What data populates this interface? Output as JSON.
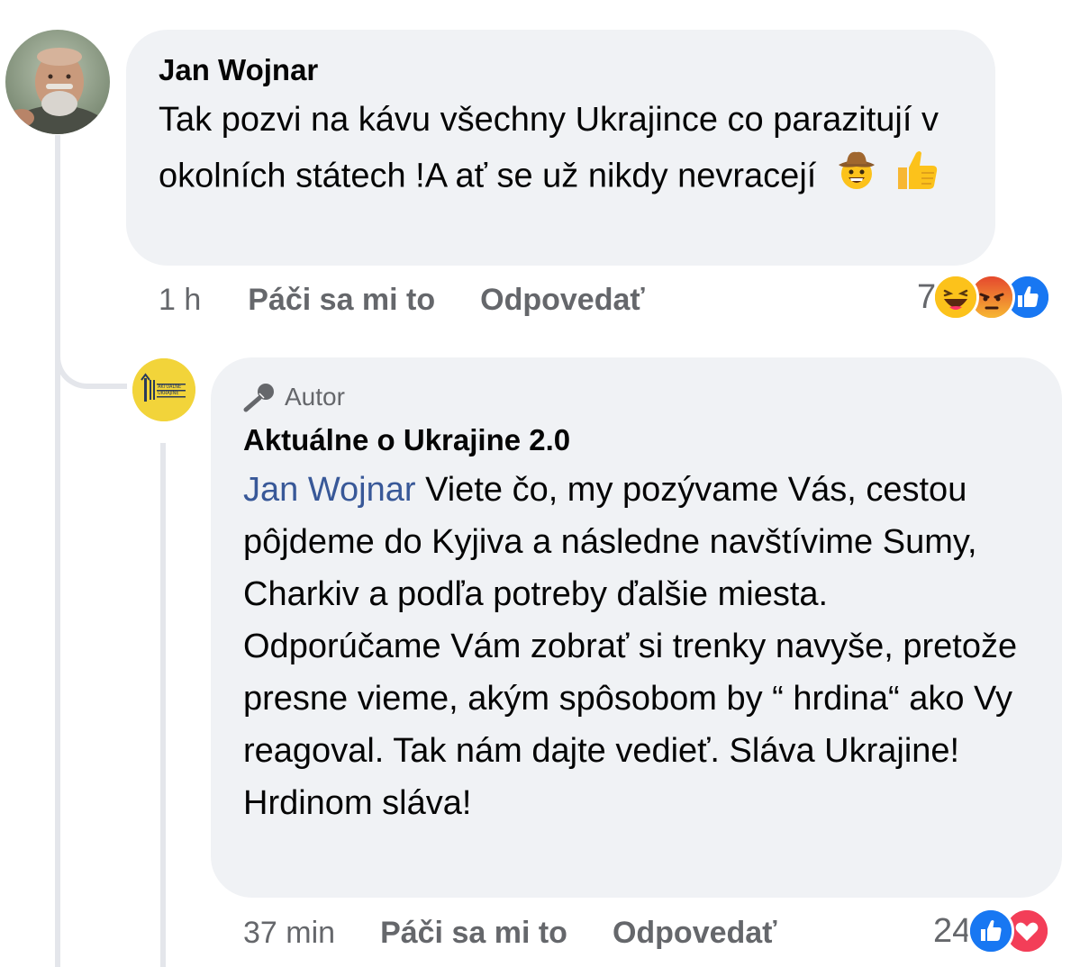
{
  "comment": {
    "author": "Jan Wojnar",
    "text": "Tak pozvi na kávu všechny Ukrajince co parazitují v okolních státech !A ať se už nikdy nevracejí",
    "emojis": [
      "cowboy-face",
      "thumbs-up"
    ],
    "time": "1 h",
    "like_label": "Páči sa mi to",
    "reply_label": "Odpovedať",
    "reaction_count": "7",
    "reactions": [
      "haha",
      "angry",
      "like"
    ]
  },
  "reply": {
    "badge_label": "Autor",
    "author": "Aktuálne o Ukrajine 2.0",
    "avatar_text_1": "AKTUÁLNE",
    "avatar_text_2": "UKRAJINE",
    "mention": "Jan Wojnar",
    "text": "Viete čo, my pozývame Vás, cestou pôjdeme do Kyjiva a následne navštívime Sumy, Charkiv a podľa potreby ďalšie miesta. Odporúčame Vám zobrať si trenky navyše, pretože presne vieme, akým spôsobom by “ hrdina“ ako Vy reagoval. Tak nám dajte vedieť. Sláva Ukrajine! Hrdinom sláva!",
    "time": "37 min",
    "like_label": "Páči sa mi to",
    "reply_label": "Odpovedať",
    "reaction_count": "24",
    "reactions": [
      "like",
      "love"
    ]
  },
  "colors": {
    "bubble": "#f0f2f5",
    "secondary_text": "#65676b",
    "mention": "#385898",
    "like_blue": "#1877f2",
    "love_red": "#f33e58",
    "avatar_yellow": "#f2d43a"
  }
}
